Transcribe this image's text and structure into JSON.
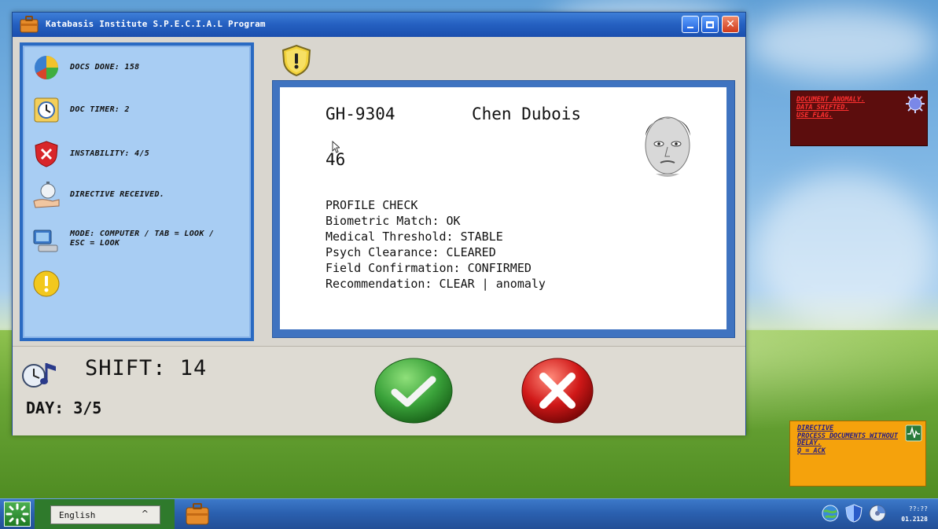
{
  "window": {
    "title": "Katabasis Institute S.P.E.C.I.A.L Program"
  },
  "status": {
    "docs_done": "DOCS DONE: 158",
    "doc_timer": "DOC TIMER: 2",
    "instability": "INSTABILITY: 4/5",
    "directive": "DIRECTIVE RECEIVED.",
    "mode": "MODE: COMPUTER  /  TAB = LOOK  /  ESC = LOOK"
  },
  "document": {
    "id": "GH-9304",
    "name": "Chen Dubois",
    "age": "46",
    "section_title": "PROFILE CHECK",
    "lines": [
      "Biometric Match: OK",
      "Medical Threshold: STABLE",
      "Psych Clearance: CLEARED",
      "Field Confirmation: CONFIRMED",
      "Recommendation: CLEAR | anomaly"
    ]
  },
  "bottom": {
    "shift": "SHIFT: 14",
    "day": "DAY: 3/5"
  },
  "notes": {
    "anomaly": [
      "DOCUMENT ANOMALY.",
      "DATA SHIFTED.",
      "USE FLAG."
    ],
    "directive": [
      "DIRECTIVE",
      "PROCESS DOCUMENTS WITHOUT DELAY.",
      "Q = ACK"
    ]
  },
  "taskbar": {
    "language": "English",
    "clock_time": "??:??",
    "clock_date": "01.2128"
  },
  "colors": {
    "titlebar": "#245fc0",
    "panel_bg": "#a8cdf3",
    "anomaly_note": "#5c0d0d",
    "directive_note": "#f5a20c",
    "approve": "#3aa23a",
    "deny": "#d01818"
  },
  "icons": [
    "briefcase-icon",
    "minimize-icon",
    "maximize-icon",
    "close-icon",
    "pie-chart-icon",
    "timer-icon",
    "shield-x-icon",
    "hand-stopwatch-icon",
    "computer-icon",
    "warning-icon",
    "shield-warning-icon",
    "clock-music-icon",
    "checkmark-icon",
    "x-icon",
    "virus-icon",
    "oscilloscope-icon",
    "start-icon",
    "globe-icon",
    "shield-icon",
    "disc-icon"
  ]
}
